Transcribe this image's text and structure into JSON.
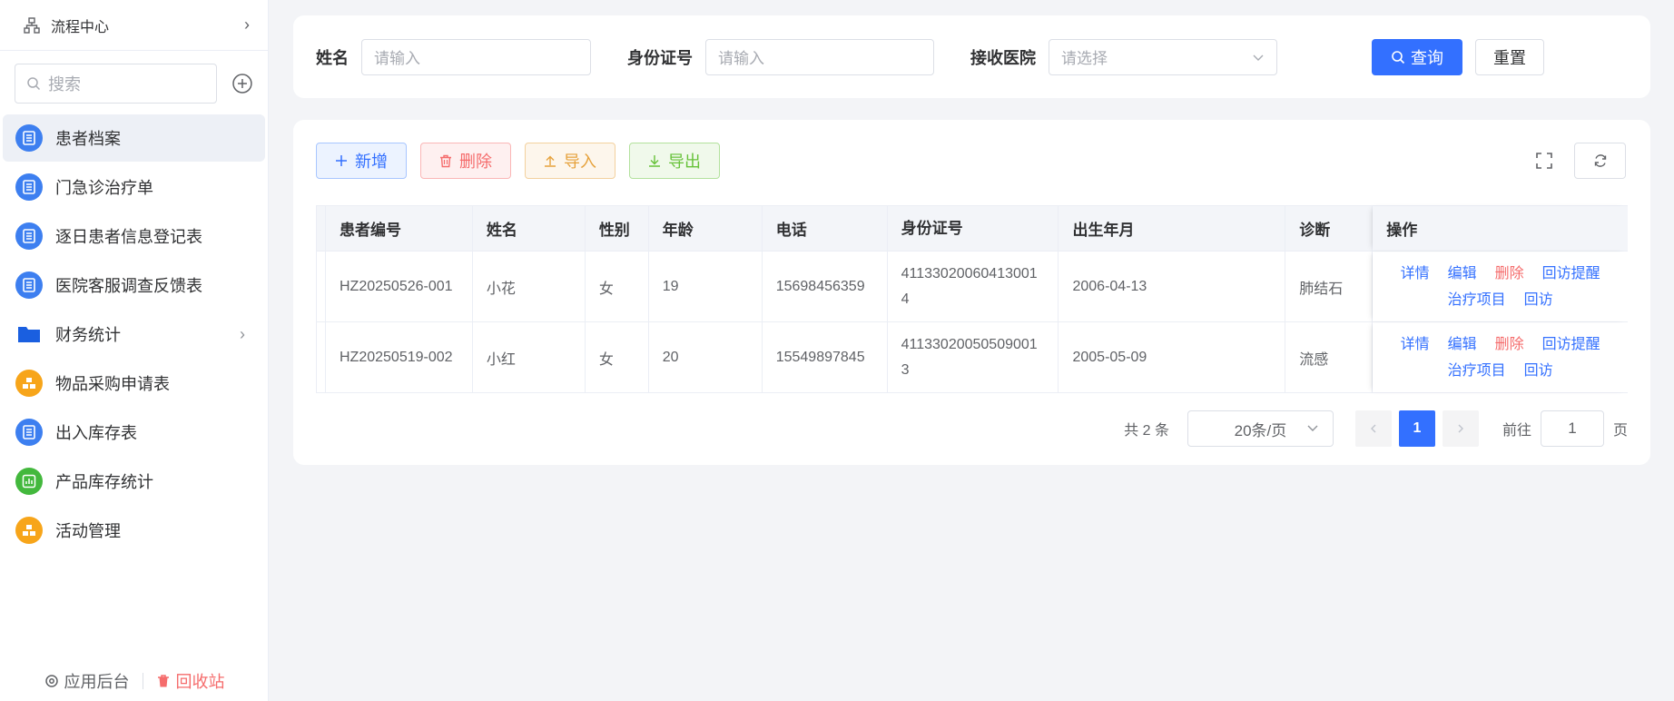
{
  "sidebar": {
    "flow_center": "流程中心",
    "search_placeholder": "搜索",
    "items": [
      {
        "label": "患者档案",
        "icon": "document-icon",
        "color": "#3d7ff0",
        "active": true
      },
      {
        "label": "门急诊治疗单",
        "icon": "document-icon",
        "color": "#3d7ff0"
      },
      {
        "label": "逐日患者信息登记表",
        "icon": "document-icon",
        "color": "#3d7ff0"
      },
      {
        "label": "医院客服调查反馈表",
        "icon": "document-icon",
        "color": "#3d7ff0"
      },
      {
        "label": "财务统计",
        "icon": "folder-icon",
        "color": "#1a5fe0",
        "has_children": true
      },
      {
        "label": "物品采购申请表",
        "icon": "boxes-icon",
        "color": "#f7a51a"
      },
      {
        "label": "出入库存表",
        "icon": "document-icon",
        "color": "#3d7ff0"
      },
      {
        "label": "产品库存统计",
        "icon": "chart-icon",
        "color": "#43b83d"
      },
      {
        "label": "活动管理",
        "icon": "boxes-icon",
        "color": "#f7a51a"
      }
    ],
    "footer": {
      "backend": "应用后台",
      "recycle": "回收站"
    }
  },
  "filter": {
    "name_label": "姓名",
    "name_placeholder": "请输入",
    "idcard_label": "身份证号",
    "idcard_placeholder": "请输入",
    "hospital_label": "接收医院",
    "hospital_placeholder": "请选择",
    "query_label": "查询",
    "reset_label": "重置"
  },
  "toolbar": {
    "add_label": "新增",
    "delete_label": "删除",
    "import_label": "导入",
    "export_label": "导出"
  },
  "table": {
    "headers": {
      "id": "患者编号",
      "name": "姓名",
      "sex": "性别",
      "age": "年龄",
      "phone": "电话",
      "idno": "身份证号",
      "birth": "出生年月",
      "diag": "诊断",
      "ops": "操作"
    },
    "rows": [
      {
        "id": "HZ20250526-001",
        "name": "小花",
        "sex": "女",
        "age": "19",
        "phone": "15698456359",
        "idno": "411330200604130014",
        "birth": "2006-04-13",
        "diag": "肺结石"
      },
      {
        "id": "HZ20250519-002",
        "name": "小红",
        "sex": "女",
        "age": "20",
        "phone": "15549897845",
        "idno": "411330200505090013",
        "birth": "2005-05-09",
        "diag": "流感"
      }
    ],
    "ops": {
      "detail": "详情",
      "edit": "编辑",
      "delete": "删除",
      "remind": "回访提醒",
      "treat": "治疗项目",
      "visit": "回访"
    }
  },
  "pagination": {
    "total": "共 2 条",
    "page_size": "20条/页",
    "current": "1",
    "goto_label": "前往",
    "goto_value": "1",
    "page_unit": "页"
  }
}
